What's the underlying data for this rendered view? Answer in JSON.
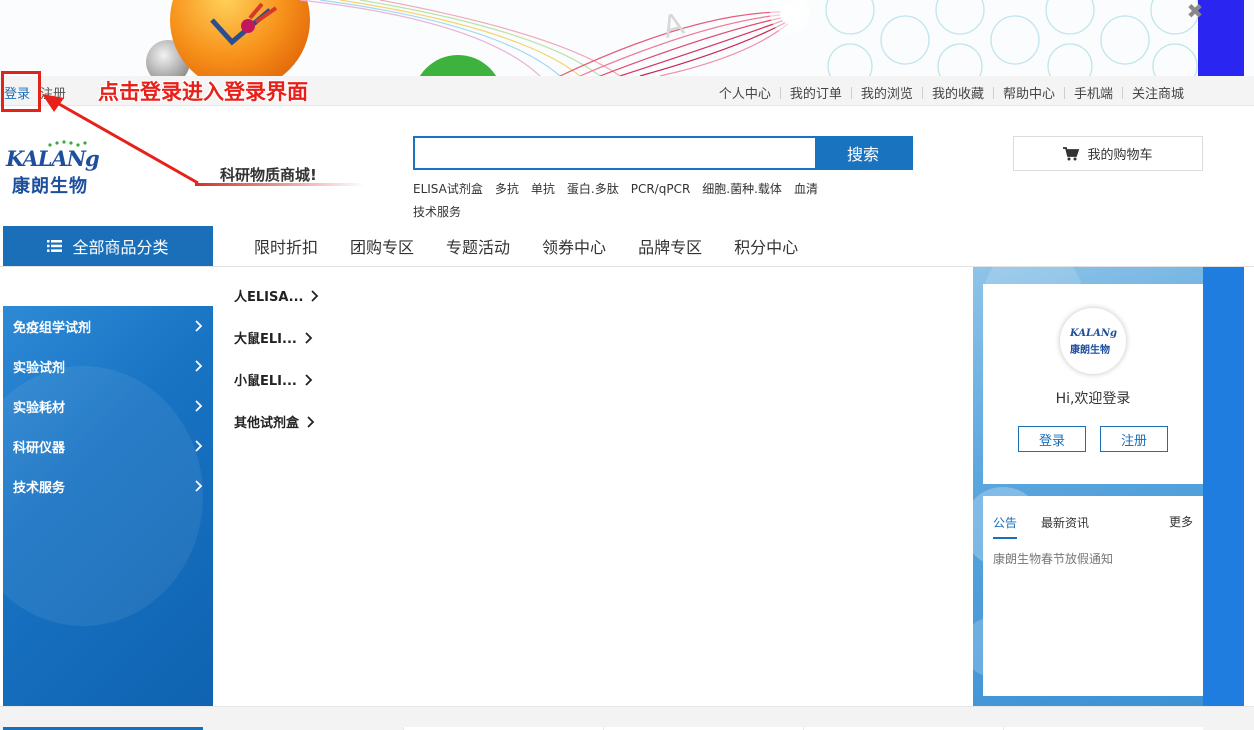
{
  "topbar": {
    "login": "登录",
    "register": "注册",
    "annotation": "点击登录进入登录界面",
    "links": [
      "个人中心",
      "我的订单",
      "我的浏览",
      "我的收藏",
      "帮助中心",
      "手机端",
      "关注商城"
    ]
  },
  "banner": {
    "close": "✖"
  },
  "header": {
    "logo_latin": "KALANg",
    "logo_cn": "康朗生物",
    "slogan": "科研物质商城!",
    "search_placeholder": "",
    "search_button": "搜索",
    "hot_keywords": [
      "ELISA试剂盒",
      "多抗",
      "单抗",
      "蛋白.多肽",
      "PCR/qPCR",
      "细胞.菌种.载体",
      "血清",
      "技术服务"
    ],
    "cart": "我的购物车"
  },
  "nav": {
    "all_categories": "全部商品分类",
    "items": [
      "限时折扣",
      "团购专区",
      "专题活动",
      "领券中心",
      "品牌专区",
      "积分中心"
    ]
  },
  "categories": [
    "免疫组学试剂",
    "实验试剂",
    "实验耗材",
    "科研仪器",
    "技术服务"
  ],
  "subcategories": [
    "人ELISA...",
    "大鼠ELI...",
    "小鼠ELI...",
    "其他试剂盒"
  ],
  "login_card": {
    "avatar_latin": "KALANg",
    "avatar_cn": "康朗生物",
    "welcome": "Hi,欢迎登录",
    "login": "登录",
    "register": "注册"
  },
  "notice": {
    "tabs": [
      "公告",
      "最新资讯"
    ],
    "more": "更多",
    "items": [
      "康朗生物春节放假通知"
    ]
  },
  "colors": {
    "brand_blue": "#1a6fb8",
    "annotation_red": "#e8201a",
    "logo_green": "#3aa83a"
  }
}
